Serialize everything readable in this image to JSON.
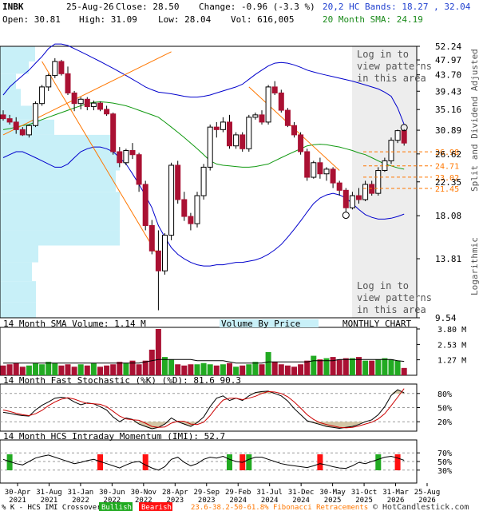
{
  "header": {
    "symbol": "INBK",
    "date": "25-Aug-26",
    "close_label": "Close: 28.50",
    "change_label": "Change: -0.96 (-3.3 %)",
    "open_label": "Open: 30.81",
    "high_label": "High: 31.09",
    "low_label": "Low: 28.04",
    "vol_label": "Vol: 616,005",
    "bands_label": "20,2 HC Bands: 18.27 , 32.04",
    "sma_label": "20 Month SMA: 24.19"
  },
  "overlay": {
    "login_top": [
      "Log in to",
      "view patterns",
      "in this area"
    ],
    "login_bottom": [
      "Log in to",
      "view patterns",
      "in this area"
    ],
    "side_axis": "Split and Dividend Adjusted",
    "log_label": "Logarithmic"
  },
  "panels": {
    "volume_title": "14 Month SMA Volume: 1.14 M",
    "vbp_title": "Volume By Price",
    "chart_kind": "MONTHLY CHART",
    "stoch_title": "14 Month Fast Stochastic (%K) (%D): 81.6  90.3",
    "imi_title": "14 Month HCS Intraday Momentum (IMI): 52.7"
  },
  "legend": {
    "crossover": "% K - HCS IMI Crossover:",
    "bullish": "Bullish",
    "bearish": "Bearish",
    "fib": "23.6-38.2-50-61.8% Fibonacci Retracements",
    "copyright": "© HotCandlestick.com"
  },
  "colors": {
    "up": "#22aa22",
    "down": "#aa1133",
    "band": "#0000cc",
    "sma": "#119911",
    "vbp": "#c8f0f8",
    "fib": "#ff7700",
    "shade": "#ededed"
  },
  "chart_data": [
    {
      "type": "candlestick",
      "title": "INBK",
      "scale": "log",
      "ylim": [
        9.54,
        52.24
      ],
      "y_ticks": [
        "52.24",
        "47.97",
        "43.70",
        "39.43",
        "35.16",
        "30.89",
        "26.62",
        "22.35",
        "18.08",
        "13.81",
        "9.54"
      ],
      "x_ticks": [
        "30-Apr 2021",
        "31-Aug 2021",
        "31-Jan 2022",
        "30-Jun 2022",
        "30-Nov 2022",
        "28-Apr 2023",
        "29-Sep 2023",
        "29-Feb 2024",
        "31-Jul 2024",
        "31-Dec 2024",
        "30-May 2025",
        "31-Oct 2025",
        "31-Mar 2026",
        "25-Aug 2026"
      ],
      "fib_levels": [
        "26.98",
        "24.71",
        "23.02",
        "21.45"
      ],
      "ohlc": [
        [
          34.0,
          35.0,
          32.8,
          33.2
        ],
        [
          33.2,
          34.0,
          32.0,
          32.5
        ],
        [
          32.5,
          33.5,
          30.2,
          31.0
        ],
        [
          31.0,
          31.5,
          29.8,
          30.0
        ],
        [
          30.0,
          32.0,
          29.5,
          31.8
        ],
        [
          31.8,
          37.0,
          31.5,
          36.5
        ],
        [
          36.5,
          41.0,
          36.0,
          40.5
        ],
        [
          40.5,
          44.0,
          39.5,
          43.5
        ],
        [
          43.5,
          48.5,
          42.8,
          47.5
        ],
        [
          47.5,
          48.0,
          43.5,
          44.0
        ],
        [
          44.0,
          46.0,
          38.5,
          39.0
        ],
        [
          39.0,
          39.5,
          34.8,
          36.5
        ],
        [
          36.5,
          38.0,
          35.2,
          37.5
        ],
        [
          37.5,
          38.0,
          35.0,
          35.8
        ],
        [
          35.8,
          37.2,
          35.0,
          36.6
        ],
        [
          36.6,
          37.0,
          34.8,
          35.2
        ],
        [
          35.2,
          36.0,
          33.8,
          34.2
        ],
        [
          34.2,
          34.5,
          26.5,
          27.0
        ],
        [
          27.0,
          27.8,
          24.5,
          25.2
        ],
        [
          25.2,
          27.5,
          24.8,
          27.2
        ],
        [
          27.2,
          28.5,
          25.8,
          26.5
        ],
        [
          26.5,
          26.8,
          21.0,
          22.0
        ],
        [
          22.0,
          22.5,
          16.5,
          17.0
        ],
        [
          17.0,
          17.6,
          14.2,
          14.5
        ],
        [
          14.5,
          16.5,
          10.0,
          12.8
        ],
        [
          12.8,
          16.2,
          12.5,
          16.0
        ],
        [
          16.0,
          25.2,
          15.5,
          24.8
        ],
        [
          24.8,
          25.5,
          19.5,
          20.0
        ],
        [
          20.0,
          21.0,
          17.5,
          18.0
        ],
        [
          18.0,
          18.4,
          16.5,
          17.2
        ],
        [
          17.2,
          21.0,
          16.8,
          20.5
        ],
        [
          20.5,
          25.0,
          20.0,
          24.5
        ],
        [
          24.5,
          32.0,
          24.0,
          31.5
        ],
        [
          31.5,
          32.5,
          29.5,
          31.0
        ],
        [
          31.0,
          33.5,
          30.5,
          32.5
        ],
        [
          32.5,
          34.0,
          27.5,
          28.0
        ],
        [
          28.0,
          30.5,
          27.5,
          30.0
        ],
        [
          30.0,
          30.5,
          27.0,
          27.5
        ],
        [
          27.5,
          34.0,
          27.0,
          33.5
        ],
        [
          33.5,
          34.5,
          33.0,
          34.0
        ],
        [
          34.0,
          35.0,
          32.0,
          32.5
        ],
        [
          32.5,
          41.0,
          32.0,
          40.5
        ],
        [
          40.5,
          42.0,
          38.5,
          39.0
        ],
        [
          39.0,
          39.8,
          34.5,
          35.0
        ],
        [
          35.0,
          35.5,
          31.5,
          31.8
        ],
        [
          31.8,
          32.5,
          29.5,
          30.0
        ],
        [
          30.0,
          30.5,
          26.5,
          27.0
        ],
        [
          27.0,
          27.5,
          22.5,
          23.0
        ],
        [
          23.0,
          25.5,
          22.8,
          25.2
        ],
        [
          25.2,
          26.0,
          22.8,
          23.5
        ],
        [
          23.5,
          24.5,
          22.5,
          24.2
        ],
        [
          24.2,
          24.5,
          21.5,
          22.2
        ],
        [
          22.2,
          22.5,
          20.5,
          21.2
        ],
        [
          21.2,
          21.5,
          18.5,
          19.0
        ],
        [
          19.0,
          21.0,
          18.8,
          20.5
        ],
        [
          20.5,
          21.5,
          19.5,
          20.0
        ],
        [
          20.0,
          22.5,
          19.8,
          22.0
        ],
        [
          22.0,
          22.5,
          20.5,
          20.8
        ],
        [
          20.8,
          24.5,
          20.5,
          24.0
        ],
        [
          24.0,
          26.0,
          23.8,
          25.5
        ],
        [
          25.5,
          29.5,
          25.0,
          29.0
        ],
        [
          29.0,
          31.0,
          28.5,
          30.8
        ],
        [
          30.8,
          31.09,
          28.04,
          28.5
        ]
      ],
      "upper_band": [
        38.5,
        40.5,
        42,
        43.5,
        45,
        47,
        49,
        51.5,
        53,
        53,
        52.5,
        51.5,
        50.5,
        49.5,
        48.5,
        47.5,
        46.5,
        45.5,
        44.5,
        43.5,
        42.5,
        41.5,
        40.5,
        39.8,
        39.2,
        39,
        38.8,
        38.5,
        38.2,
        38,
        38,
        38.2,
        38.5,
        39,
        39.5,
        40,
        40.5,
        41.2,
        42.5,
        43.8,
        45,
        46.2,
        47,
        47.2,
        47,
        46.5,
        45.8,
        45,
        44.5,
        44,
        43.6,
        43.2,
        42.8,
        42.4,
        42,
        41.5,
        41,
        40.5,
        40,
        39.2,
        38.2,
        35.5,
        32.04
      ],
      "lower_band": [
        26,
        26.5,
        27,
        27,
        26.5,
        26,
        25.5,
        25,
        24.5,
        24.5,
        25,
        26,
        27,
        27.5,
        27.8,
        27.8,
        27.5,
        27,
        26,
        25,
        23.5,
        22,
        20.5,
        19,
        17,
        15.8,
        14.8,
        14.2,
        13.8,
        13.5,
        13.3,
        13.2,
        13.2,
        13.3,
        13.3,
        13.4,
        13.5,
        13.5,
        13.6,
        13.7,
        13.9,
        14.2,
        14.6,
        15.1,
        15.8,
        16.6,
        17.5,
        18.5,
        19.5,
        20.2,
        20.6,
        20.8,
        20.6,
        20.2,
        19.5,
        18.8,
        18.2,
        17.9,
        17.7,
        17.7,
        17.8,
        18,
        18.27
      ],
      "sma20": [
        31,
        31.2,
        31.5,
        31.8,
        32,
        32.5,
        33,
        33.5,
        34,
        34.5,
        35,
        35.5,
        36,
        36.5,
        36.8,
        36.9,
        36.8,
        36.6,
        36.3,
        36,
        35.5,
        35,
        34.5,
        34,
        33.5,
        32.5,
        31.5,
        30.5,
        29.5,
        28.5,
        27.5,
        26.5,
        25.5,
        25,
        24.8,
        24.7,
        24.6,
        24.5,
        24.5,
        24.6,
        24.8,
        25,
        25.5,
        26,
        26.5,
        27,
        27.5,
        28,
        28.2,
        28.3,
        28.2,
        28,
        27.8,
        27.5,
        27.2,
        26.8,
        26.5,
        26,
        25.5,
        25,
        24.7,
        24.4,
        24.19
      ],
      "fib_lines": [
        {
          "from": 0,
          "to": 26,
          "fromV": 30.0,
          "toV": 50.5
        },
        {
          "from": 6,
          "to": 24,
          "fromV": 47.5,
          "toV": 14.0
        },
        {
          "from": 38,
          "to": 52,
          "fromV": 40.5,
          "toV": 24.0
        }
      ]
    },
    {
      "type": "bar",
      "title": "14 Month SMA Volume: 1.14 M",
      "ylim": [
        0,
        3.8
      ],
      "y_ticks": [
        "3.80 M",
        "2.53 M",
        "1.27 M"
      ],
      "values": [
        0.8,
        0.9,
        1.0,
        0.7,
        0.8,
        1.0,
        0.9,
        1.1,
        1.0,
        0.8,
        0.9,
        0.7,
        0.9,
        0.8,
        1.0,
        0.7,
        0.8,
        0.9,
        1.1,
        1.0,
        1.2,
        0.9,
        1.2,
        2.1,
        3.8,
        1.5,
        1.3,
        0.9,
        0.8,
        0.9,
        0.9,
        1.0,
        0.9,
        0.8,
        0.9,
        1.0,
        0.7,
        0.8,
        0.9,
        1.1,
        0.9,
        1.9,
        1.1,
        0.9,
        0.8,
        0.7,
        0.9,
        1.2,
        1.6,
        1.3,
        1.4,
        1.5,
        1.3,
        1.4,
        1.4,
        1.5,
        1.2,
        1.2,
        1.3,
        1.4,
        1.3,
        1.2,
        0.6
      ],
      "sma": [
        1.0,
        1.0,
        1.0,
        1.0,
        1.0,
        1.0,
        1.0,
        1.0,
        1.0,
        1.0,
        1.0,
        1.0,
        1.0,
        1.0,
        1.0,
        1.0,
        1.0,
        1.0,
        1.0,
        1.0,
        1.0,
        1.0,
        1.1,
        1.2,
        1.3,
        1.3,
        1.3,
        1.3,
        1.3,
        1.3,
        1.2,
        1.2,
        1.2,
        1.2,
        1.2,
        1.1,
        1.0,
        1.0,
        1.0,
        1.0,
        1.0,
        1.1,
        1.1,
        1.1,
        1.1,
        1.1,
        1.1,
        1.1,
        1.2,
        1.2,
        1.2,
        1.2,
        1.3,
        1.3,
        1.3,
        1.3,
        1.3,
        1.3,
        1.3,
        1.3,
        1.3,
        1.2,
        1.14
      ]
    },
    {
      "type": "line",
      "title": "14 Month Fast Stochastic (%K) (%D)",
      "ylim": [
        0,
        100
      ],
      "y_ticks": [
        "80%",
        "50%",
        "20%"
      ],
      "series": [
        {
          "name": "%K",
          "values": [
            40,
            38,
            35,
            33,
            32,
            45,
            55,
            62,
            70,
            72,
            70,
            62,
            56,
            60,
            58,
            52,
            45,
            30,
            20,
            28,
            25,
            15,
            10,
            5,
            8,
            15,
            28,
            20,
            15,
            10,
            18,
            30,
            52,
            70,
            75,
            65,
            70,
            65,
            75,
            82,
            84,
            85,
            80,
            75,
            64,
            48,
            35,
            22,
            18,
            14,
            10,
            8,
            6,
            8,
            10,
            14,
            20,
            24,
            35,
            52,
            76,
            88,
            81.6
          ]
        },
        {
          "name": "%D",
          "values": [
            45,
            42,
            38,
            35,
            33,
            37,
            44,
            54,
            62,
            68,
            71,
            68,
            63,
            59,
            58,
            57,
            52,
            42,
            32,
            26,
            24,
            23,
            17,
            10,
            8,
            9,
            17,
            21,
            21,
            15,
            14,
            19,
            33,
            51,
            66,
            70,
            70,
            67,
            70,
            74,
            80,
            84,
            83,
            80,
            73,
            62,
            49,
            35,
            25,
            18,
            14,
            11,
            8,
            7,
            8,
            11,
            15,
            19,
            26,
            37,
            54,
            72,
            90.3
          ]
        }
      ]
    },
    {
      "type": "line",
      "title": "14 Month HCS Intraday Momentum (IMI)",
      "ylim": [
        0,
        100
      ],
      "y_ticks": [
        "70%",
        "50%",
        "30%"
      ],
      "series": [
        {
          "name": "IMI",
          "values": [
            55,
            50,
            45,
            42,
            50,
            58,
            62,
            65,
            60,
            55,
            50,
            45,
            48,
            52,
            55,
            50,
            45,
            40,
            35,
            42,
            48,
            50,
            42,
            35,
            30,
            38,
            55,
            60,
            48,
            40,
            45,
            55,
            60,
            58,
            62,
            55,
            50,
            48,
            55,
            60,
            60,
            55,
            50,
            45,
            42,
            40,
            38,
            36,
            40,
            45,
            42,
            38,
            35,
            34,
            40,
            48,
            45,
            50,
            55,
            60,
            62,
            58,
            52.7
          ]
        }
      ],
      "crossovers": [
        {
          "i": 1,
          "dir": "bullish"
        },
        {
          "i": 15,
          "dir": "bearish"
        },
        {
          "i": 22,
          "dir": "bearish"
        },
        {
          "i": 35,
          "dir": "bullish"
        },
        {
          "i": 37,
          "dir": "bearish"
        },
        {
          "i": 38,
          "dir": "bullish"
        },
        {
          "i": 49,
          "dir": "bearish"
        },
        {
          "i": 58,
          "dir": "bullish"
        },
        {
          "i": 61,
          "dir": "bearish"
        }
      ]
    }
  ]
}
